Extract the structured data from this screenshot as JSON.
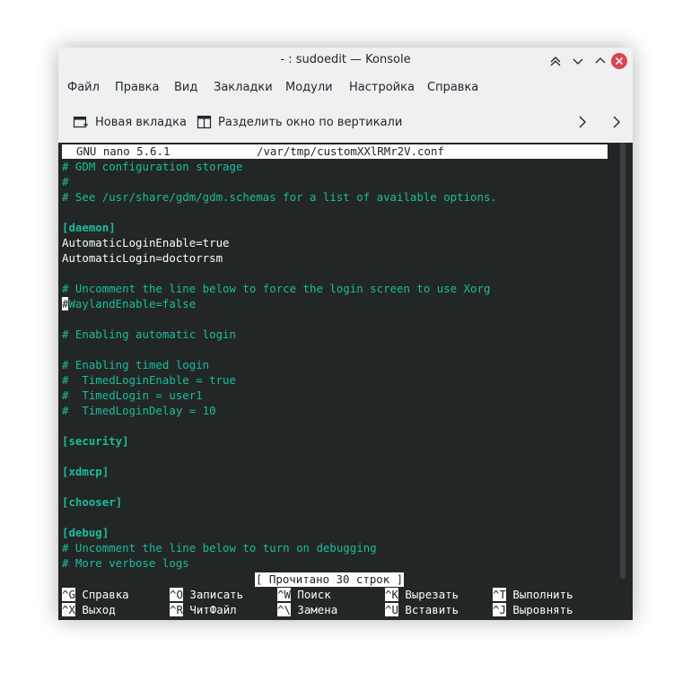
{
  "window": {
    "title": "- : sudoedit — Konsole"
  },
  "menu": [
    "Файл",
    "Правка",
    "Вид",
    "Закладки",
    "Модули",
    "Настройка",
    "Справка"
  ],
  "toolbar": {
    "new_tab": "Новая вкладка",
    "split_vertical": "Разделить окно по вертикали"
  },
  "nano": {
    "version": "GNU nano 5.6.1",
    "filename": "/var/tmp/customXXlRMr2V.conf",
    "status": "[ Прочитано 30 строк ]",
    "cursor_char": "#",
    "lines": [
      {
        "text": "# GDM configuration storage",
        "style": "comment"
      },
      {
        "text": "#",
        "style": "comment"
      },
      {
        "text": "# See /usr/share/gdm/gdm.schemas for a list of available options.",
        "style": "comment"
      },
      {
        "text": "",
        "style": "normal"
      },
      {
        "text": "[daemon]",
        "style": "section"
      },
      {
        "text": "AutomaticLoginEnable=true",
        "style": "normal"
      },
      {
        "text": "AutomaticLogin=doctorrsm",
        "style": "normal"
      },
      {
        "text": "",
        "style": "normal"
      },
      {
        "text": "# Uncomment the line below to force the login screen to use Xorg",
        "style": "comment"
      },
      {
        "text": "WaylandEnable=false",
        "style": "comment"
      },
      {
        "text": "",
        "style": "normal"
      },
      {
        "text": "# Enabling automatic login",
        "style": "comment"
      },
      {
        "text": "",
        "style": "normal"
      },
      {
        "text": "# Enabling timed login",
        "style": "comment"
      },
      {
        "text": "#  TimedLoginEnable = true",
        "style": "comment"
      },
      {
        "text": "#  TimedLogin = user1",
        "style": "comment"
      },
      {
        "text": "#  TimedLoginDelay = 10",
        "style": "comment"
      },
      {
        "text": "",
        "style": "normal"
      },
      {
        "text": "[security]",
        "style": "section"
      },
      {
        "text": "",
        "style": "normal"
      },
      {
        "text": "[xdmcp]",
        "style": "section"
      },
      {
        "text": "",
        "style": "normal"
      },
      {
        "text": "[chooser]",
        "style": "section"
      },
      {
        "text": "",
        "style": "normal"
      },
      {
        "text": "[debug]",
        "style": "section"
      },
      {
        "text": "# Uncomment the line below to turn on debugging",
        "style": "comment"
      },
      {
        "text": "# More verbose logs",
        "style": "comment"
      }
    ],
    "shortcuts": [
      [
        {
          "key": "^G",
          "label": "Справка"
        },
        {
          "key": "^O",
          "label": "Записать"
        },
        {
          "key": "^W",
          "label": "Поиск"
        },
        {
          "key": "^K",
          "label": "Вырезать"
        },
        {
          "key": "^T",
          "label": "Выполнить"
        }
      ],
      [
        {
          "key": "^X",
          "label": "Выход"
        },
        {
          "key": "^R",
          "label": "ЧитФайл"
        },
        {
          "key": "^\\",
          "label": "Замена"
        },
        {
          "key": "^U",
          "label": "Вставить"
        },
        {
          "key": "^J",
          "label": "Выровнять"
        }
      ]
    ]
  },
  "colors": {
    "terminal_bg": "#232627",
    "comment": "#1abc9c",
    "text": "#fcfcfc",
    "close_button": "#da4453"
  }
}
